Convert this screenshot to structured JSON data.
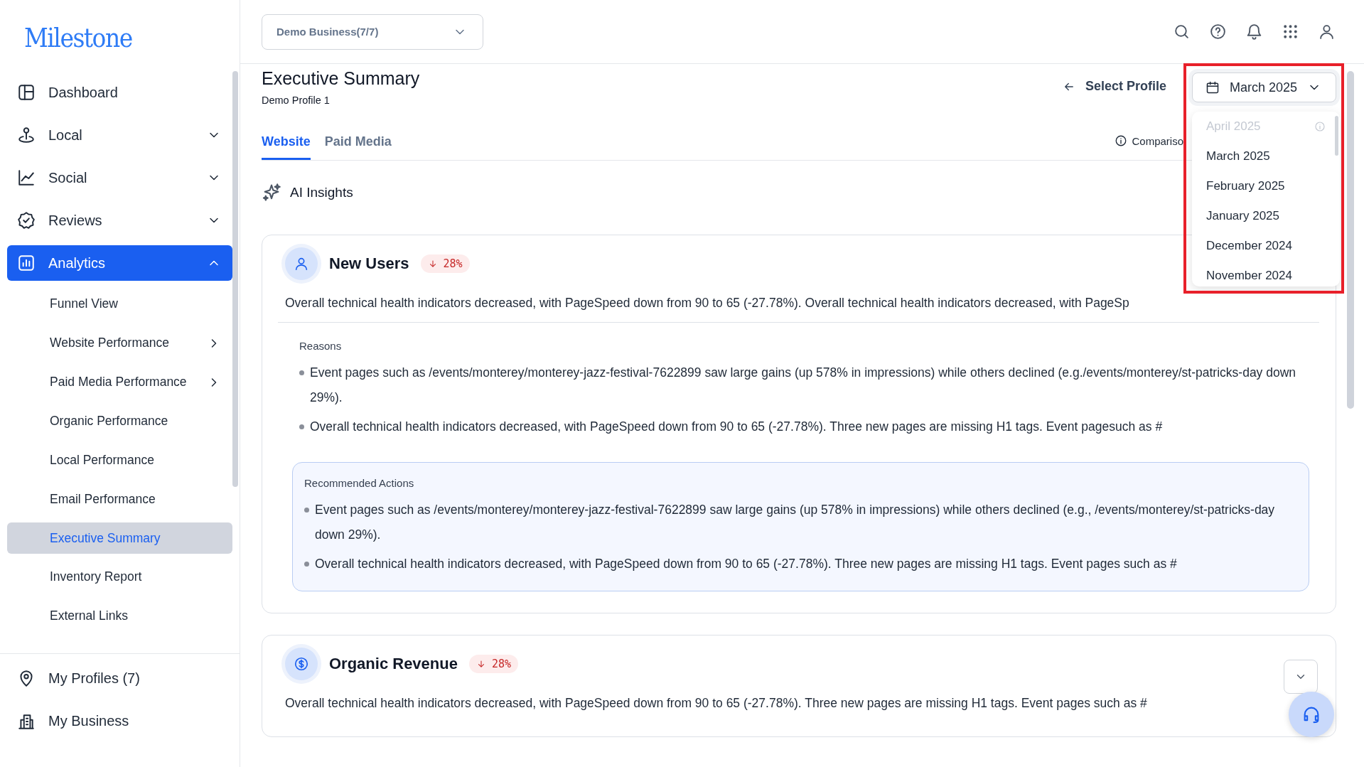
{
  "logo": {
    "text": "Milestone"
  },
  "sidebar": {
    "items": [
      {
        "label": "Dashboard",
        "expandable": false,
        "expanded": false
      },
      {
        "label": "Local",
        "expandable": true,
        "expanded": false
      },
      {
        "label": "Social",
        "expandable": true,
        "expanded": false
      },
      {
        "label": "Reviews",
        "expandable": true,
        "expanded": false
      },
      {
        "label": "Analytics",
        "expandable": true,
        "expanded": true,
        "children": [
          {
            "label": "Funnel View",
            "submenu": false,
            "selected": false
          },
          {
            "label": "Website Performance",
            "submenu": true,
            "selected": false
          },
          {
            "label": "Paid Media Performance",
            "submenu": true,
            "selected": false
          },
          {
            "label": "Organic Performance",
            "submenu": false,
            "selected": false
          },
          {
            "label": "Local Performance",
            "submenu": false,
            "selected": false
          },
          {
            "label": "Email Performance",
            "submenu": false,
            "selected": false
          },
          {
            "label": "Executive Summary",
            "submenu": false,
            "selected": true
          },
          {
            "label": "Inventory Report",
            "submenu": false,
            "selected": false
          },
          {
            "label": "External Links",
            "submenu": false,
            "selected": false
          }
        ]
      }
    ],
    "footer_items": [
      {
        "label": "My Profiles (7)"
      },
      {
        "label": "My Business"
      }
    ]
  },
  "header": {
    "business_select": {
      "value": "Demo Business(7/7)"
    }
  },
  "page": {
    "title": "Executive Summary",
    "subtitle": "Demo Profile 1",
    "back_link": "Select Profile",
    "month_select": {
      "value": "March 2025",
      "open": true,
      "options": [
        {
          "label": "April 2025",
          "disabled": true
        },
        {
          "label": "March 2025",
          "disabled": false
        },
        {
          "label": "February 2025",
          "disabled": false
        },
        {
          "label": "January 2025",
          "disabled": false
        },
        {
          "label": "December 2024",
          "disabled": false
        },
        {
          "label": "November 2024",
          "disabled": false
        }
      ]
    },
    "tabs": [
      {
        "label": "Website",
        "selected": true
      },
      {
        "label": "Paid Media",
        "selected": false
      }
    ],
    "comparisons": "Compariso",
    "section_title": "AI Insights",
    "cards": [
      {
        "title": "New Users",
        "change": "28%",
        "summary": "Overall technical health indicators decreased, with PageSpeed down from 90 to 65 (-27.78%). Overall technical health indicators decreased, with PageSp",
        "reasons": {
          "title": "Reasons",
          "items": [
            "Event pages such as /events/monterey/monterey-jazz-festival-7622899 saw large gains (up 578% in impressions) while others declined (e.g./events/monterey/st-patricks-day down 29%).",
            "Overall technical health indicators decreased, with PageSpeed down from 90 to 65 (-27.78%). Three new pages are missing H1 tags. Event pagesuch as #"
          ]
        },
        "actions": {
          "title": "Recommended Actions",
          "items": [
            "Event pages such as /events/monterey/monterey-jazz-festival-7622899 saw large gains (up 578% in impressions) while others declined (e.g., /events/monterey/st-patricks-day down 29%).",
            "Overall technical health indicators decreased, with PageSpeed down from 90 to 65 (-27.78%). Three new pages are missing H1 tags. Event pages such as #"
          ]
        }
      },
      {
        "title": "Organic Revenue",
        "change": "28%",
        "summary": "Overall technical health indicators decreased, with PageSpeed down from 90 to 65 (-27.78%). Three new pages are missing H1 tags. Event pages such as #",
        "collapsible": true
      }
    ]
  }
}
